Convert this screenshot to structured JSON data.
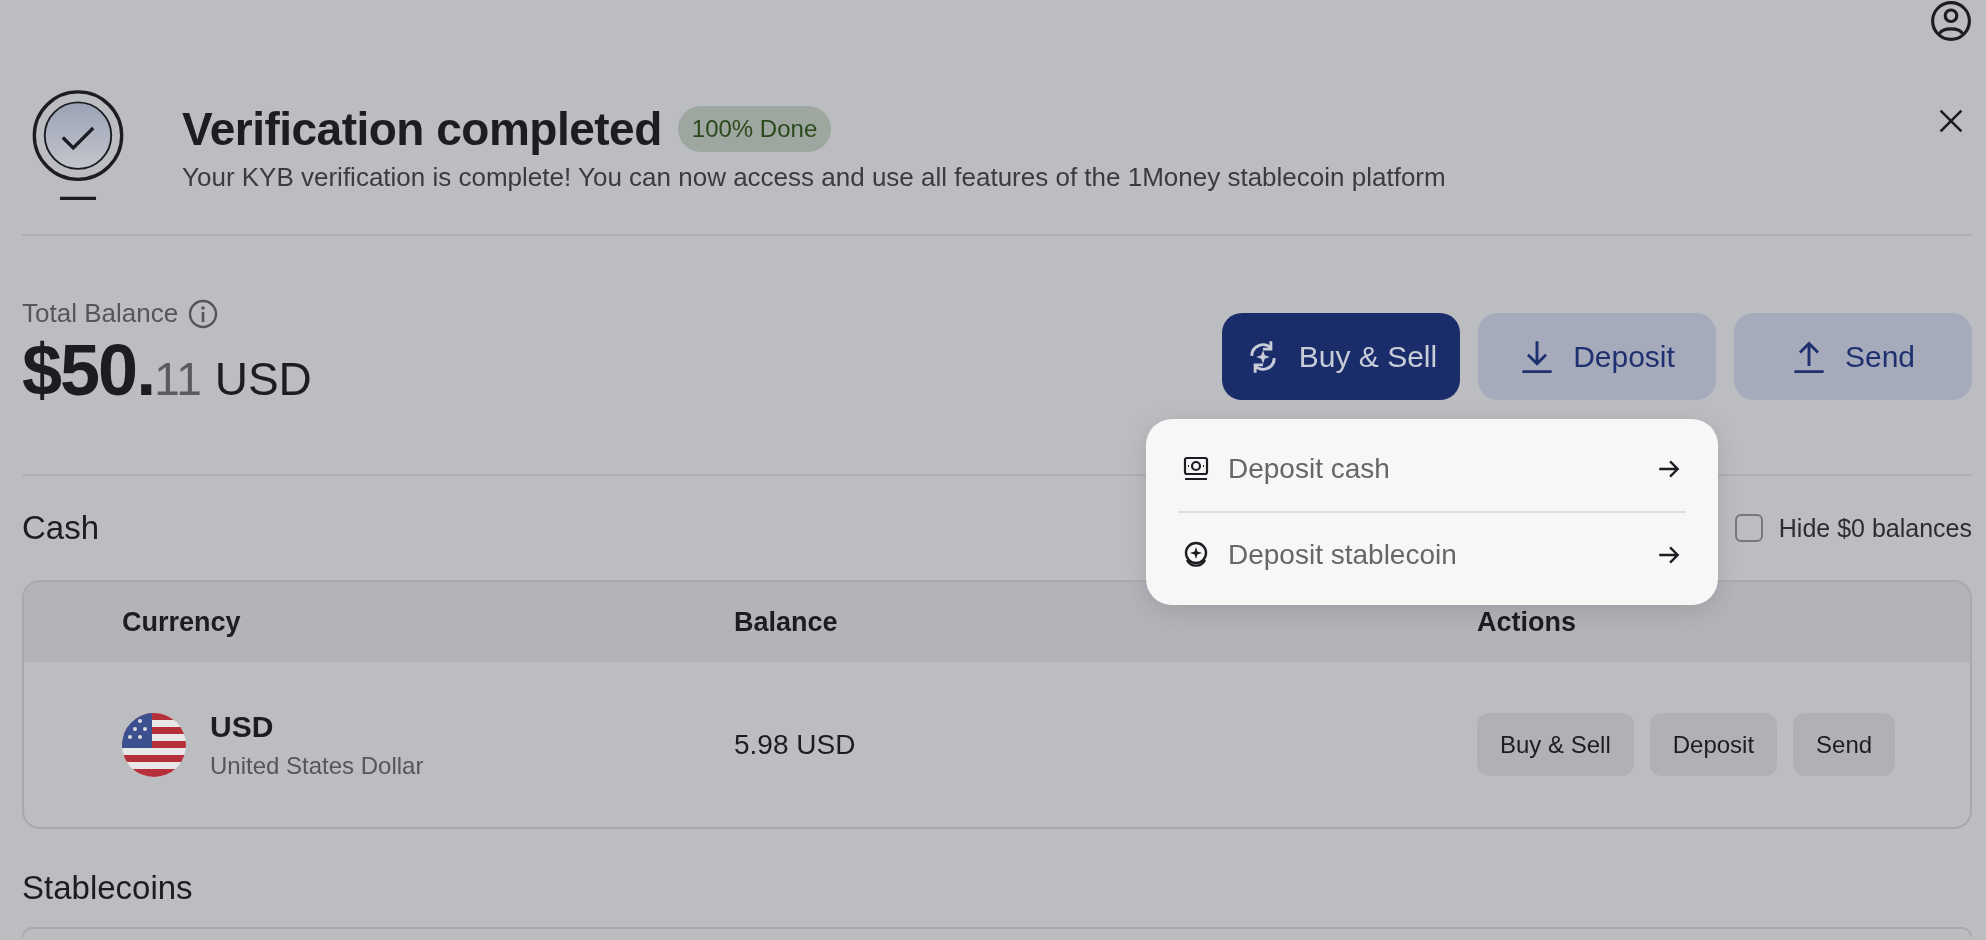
{
  "banner": {
    "title": "Verification completed",
    "badge": "100% Done",
    "message": "Your KYB verification is complete! You can now access and use all features of the 1Money stablecoin platform"
  },
  "balance": {
    "label": "Total Balance",
    "amount_whole": "$50.",
    "amount_cents": "11",
    "currency": "USD"
  },
  "actions": [
    {
      "label": "Buy & Sell",
      "kind": "buy_sell",
      "primary": true
    },
    {
      "label": "Deposit",
      "kind": "deposit",
      "primary": false
    },
    {
      "label": "Send",
      "kind": "send",
      "primary": false
    }
  ],
  "deposit_menu": {
    "items": [
      {
        "label": "Deposit cash",
        "kind": "cash"
      },
      {
        "label": "Deposit stablecoin",
        "kind": "stablecoin"
      }
    ]
  },
  "cash": {
    "title": "Cash",
    "hide_zero": {
      "label": "Hide $0 balances",
      "checked": false
    },
    "table": {
      "columns": [
        "Currency",
        "Balance",
        "Actions"
      ],
      "rows": [
        {
          "code": "USD",
          "name": "United States Dollar",
          "balance": "5.98 USD",
          "actions": [
            "Buy & Sell",
            "Deposit",
            "Send"
          ]
        }
      ]
    }
  },
  "stablecoins": {
    "title": "Stablecoins"
  }
}
